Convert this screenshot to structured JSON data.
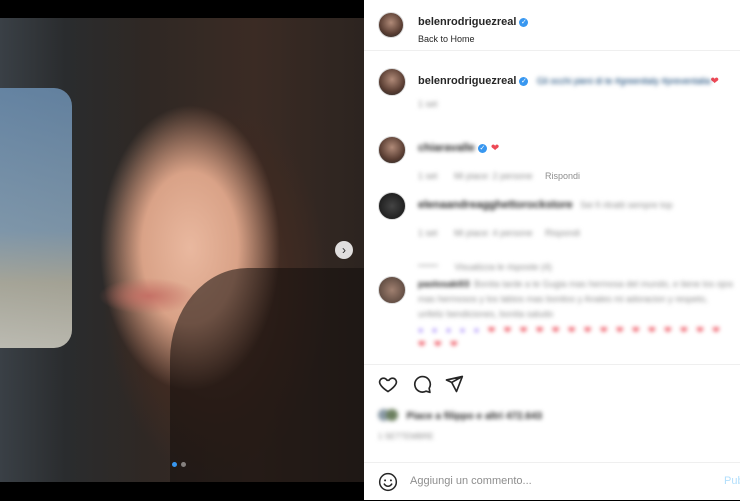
{
  "header": {
    "username": "belenrodriguezreal",
    "subtitle": "Back to Home"
  },
  "caption": {
    "username": "belenrodriguezreal",
    "text": "Gli occhi pieni di te #greenitaly #preventalia",
    "time": "1 set"
  },
  "comments": [
    {
      "username": "chiaravalle",
      "text": "",
      "time": "1 set",
      "likes": "Mi piace: 2 persone",
      "reply_label": "Rispondi"
    },
    {
      "username": "elenaandreagghettorockstore",
      "text": "Sei fi ritratti sempre top",
      "time": "1 set",
      "likes": "Mi piace: 4 persone",
      "reply_label": "Rispondi"
    },
    {
      "username": "paolosaki03",
      "text": "Bonita tarde a te Gugia  mas hermosa del mundo, e tiene los ojos mas hermosos y los labios mas bonitos y Anales mi adoracion y respeto, unfeliz bendiciones, bonita saludo",
      "time": "",
      "likes": "",
      "reply_label": ""
    }
  ],
  "view_replies": "Visualizza le risposte (4)",
  "likes_summary": "Piace a filippo e altri 472.643",
  "post_date": "1 SETTEMBRE",
  "add_comment": {
    "placeholder": "Aggiungi un commento...",
    "post_label": "Pub"
  },
  "icons": {
    "emoji": "smile-icon",
    "like": "heart-icon",
    "comment": "comment-icon",
    "share": "send-icon",
    "verified": "verified-badge-icon",
    "next": "chevron-right-icon"
  },
  "colors": {
    "accent": "#3897f0",
    "heart": "#ed4956",
    "muted": "#8e8e8e"
  },
  "carousel": {
    "total": 2,
    "current": 1
  }
}
